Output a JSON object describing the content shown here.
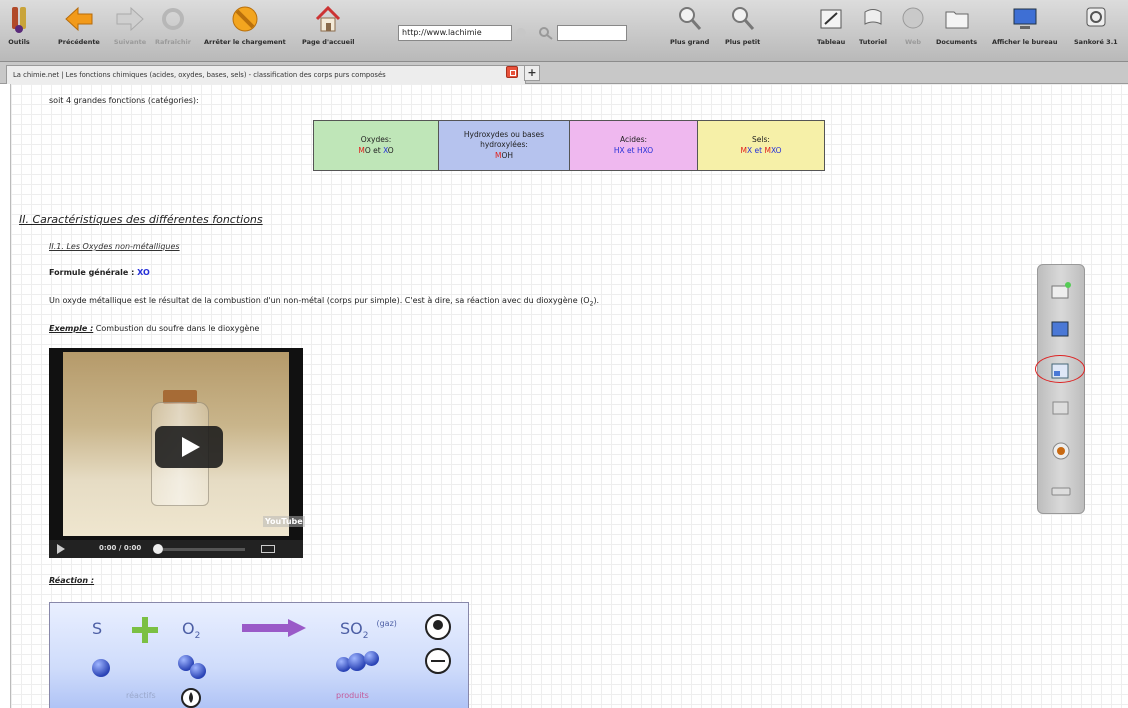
{
  "toolbar": {
    "outils": "Outils",
    "precedente": "Précédente",
    "suivante": "Suivante",
    "rafraichir": "Rafraîchir",
    "arreter": "Arrêter le chargement",
    "accueil": "Page d'accueil",
    "url": "http://www.lachimie",
    "plus_grand": "Plus grand",
    "plus_petit": "Plus petit",
    "tableau": "Tableau",
    "tutoriel": "Tutoriel",
    "web": "Web",
    "documents": "Documents",
    "afficher_bureau": "Afficher le bureau",
    "sankore": "Sankoré 3.1"
  },
  "tab": {
    "title": "La chimie.net | Les fonctions chimiques (acides, oxydes, bases, sels) - classification des corps purs composés"
  },
  "content": {
    "intro": "soit 4 grandes fonctions (catégories):",
    "functions": [
      {
        "name": "Oxydes:",
        "f1": "M",
        "f1b": "O et ",
        "f2": "X",
        "f2b": "O"
      },
      {
        "name": "Hydroxydes ou bases hydroxylées:",
        "f1": "M",
        "f1b": "OH"
      },
      {
        "name": "Acides:",
        "formula": "HX et HXO"
      },
      {
        "name": "Sels:",
        "f1": "M",
        "f1b": "X et ",
        "f2": "M",
        "f2b": "XO"
      }
    ],
    "section_title": "II. Caractéristiques des différentes fonctions",
    "subsection_title": "II.1. Les Oxydes non-métalliques",
    "formula_label": "Formule générale : ",
    "formula_value": "XO",
    "description": "Un oxyde métallique est le résultat de la combustion d'un non-métal (corps pur simple). C'est à dire, sa réaction avec du dioxygène (O",
    "description_sub": "2",
    "description_end": ").",
    "example_label": "Exemple :",
    "example_text": " Combustion du soufre dans le dioxygène",
    "video": {
      "time": "0:00 / 0:00",
      "logo": "YouTube"
    },
    "reaction_label": "Réaction :",
    "reaction": {
      "s": "S",
      "o2": "O",
      "o2_sub": "2",
      "so2": "SO",
      "so2_sub": "2",
      "gaz": "(gaz)",
      "reactifs": "réactifs",
      "produits": "produits"
    }
  },
  "colors": {
    "oxydes_bg": "#bfe6b8",
    "hydroxydes_bg": "#b6c3ee",
    "acides_bg": "#efb8ef",
    "sels_bg": "#f6f0a8"
  }
}
